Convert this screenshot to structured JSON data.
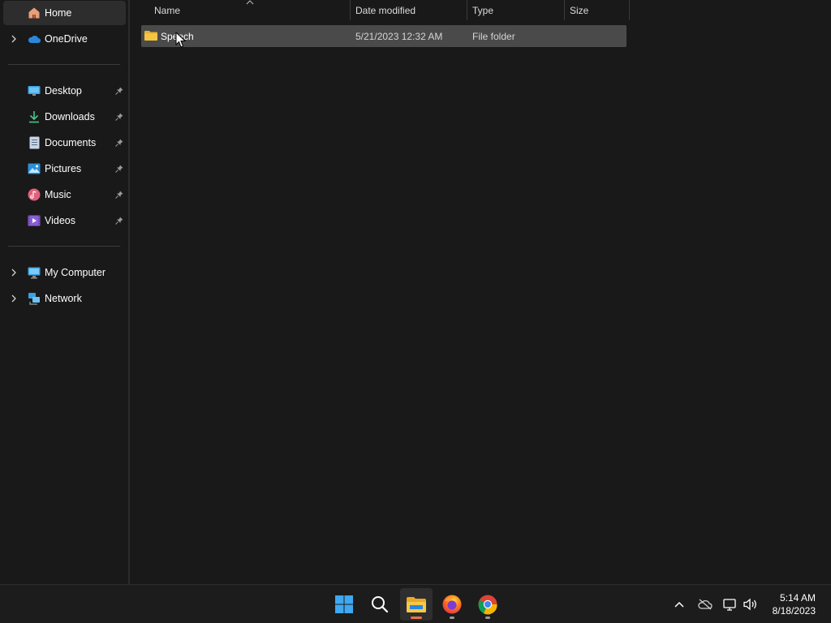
{
  "sidebar": {
    "top_items": [
      {
        "label": "Home",
        "icon": "home-icon",
        "active": true,
        "expandable": false
      },
      {
        "label": "OneDrive",
        "icon": "onedrive-icon",
        "active": false,
        "expandable": true
      }
    ],
    "quick_access": [
      {
        "label": "Desktop",
        "icon": "desktop-icon",
        "pinned": true
      },
      {
        "label": "Downloads",
        "icon": "downloads-icon",
        "pinned": true
      },
      {
        "label": "Documents",
        "icon": "documents-icon",
        "pinned": true
      },
      {
        "label": "Pictures",
        "icon": "pictures-icon",
        "pinned": true
      },
      {
        "label": "Music",
        "icon": "music-icon",
        "pinned": true
      },
      {
        "label": "Videos",
        "icon": "videos-icon",
        "pinned": true
      }
    ],
    "locations": [
      {
        "label": "My Computer",
        "icon": "computer-icon",
        "expandable": true
      },
      {
        "label": "Network",
        "icon": "network-icon",
        "expandable": true
      }
    ]
  },
  "file_list": {
    "columns": [
      "Name",
      "Date modified",
      "Type",
      "Size"
    ],
    "rows": [
      {
        "name": "Speech",
        "date_modified": "5/21/2023 12:32 AM",
        "type": "File folder",
        "size": "",
        "selected": true
      }
    ]
  },
  "taskbar": {
    "apps": [
      {
        "name": "start-button",
        "icon": "windows-logo-icon"
      },
      {
        "name": "search-button",
        "icon": "search-icon"
      },
      {
        "name": "file-explorer-button",
        "icon": "file-explorer-icon",
        "active": true
      },
      {
        "name": "firefox-button",
        "icon": "firefox-icon",
        "running": true
      },
      {
        "name": "chrome-button",
        "icon": "chrome-icon",
        "running": true
      }
    ],
    "tray": {
      "icons": [
        "chevron-up-icon",
        "onedrive-offline-icon",
        "network-icon",
        "volume-icon"
      ],
      "time": "5:14 AM",
      "date": "8/18/2023"
    }
  },
  "colors": {
    "background": "#191919",
    "selected_row": "#4a4a4a",
    "active_nav": "#2d2d2d",
    "accent_indicator": "#e8734a",
    "running_indicator": "#9a9a9a",
    "folder_yellow": "#f4c542"
  }
}
